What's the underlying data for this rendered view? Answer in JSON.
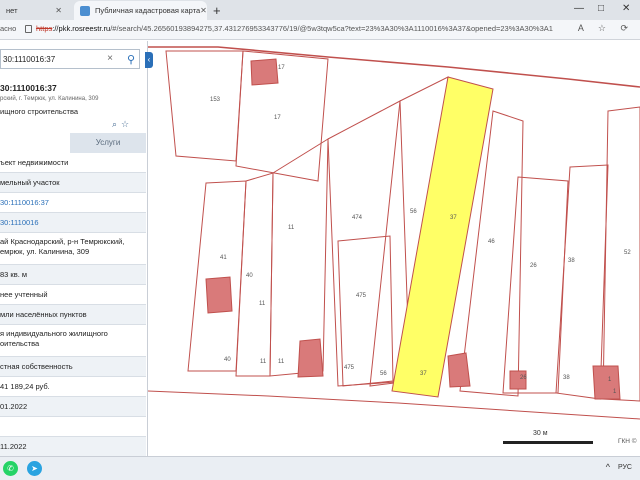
{
  "browser": {
    "tab_inactive": "нет",
    "tab_active": "Публичная кадастровая карта",
    "newtab_glyph": "+",
    "window_controls": [
      "—",
      "□",
      "✕"
    ],
    "addr_security": "асно",
    "url_scheme": "https",
    "url_host": "://pkk.rosreestr.ru",
    "url_rest": "/#/search/45.26560193894275,37.431276953343776/19/@5w3tqw5ca?text=23%3A30%3A1110016%3A37&opened=23%3A30%3A1",
    "addr_icons": "A ☆ ⟳"
  },
  "panel": {
    "search_value": "30:1110016:37",
    "obj_title": "30:1110016:37",
    "obj_address": "рский, г. Темрюк, ул. Калинина, 309",
    "obj_type": "ищного строительства",
    "tab_services": "Услуги",
    "rows": [
      {
        "text": "ъект недвижимости",
        "style": "plain"
      },
      {
        "text": "мельный участок",
        "style": "plain"
      },
      {
        "text": "30:1110016:37",
        "style": "link"
      },
      {
        "text": "30:1110016",
        "style": "link"
      },
      {
        "text": "ай Краснодарский, р-н Темрюкский, емрюк, ул. Калинина, 309",
        "style": "tall"
      },
      {
        "text": "83 кв. м",
        "style": "plain"
      },
      {
        "text": "нее учтенный",
        "style": "plain"
      },
      {
        "text": "мли населённых пунктов",
        "style": "plain"
      },
      {
        "text": "я индивидуального жилищного оительства",
        "style": "tall"
      },
      {
        "text": "стная собственность",
        "style": "plain"
      },
      {
        "text": "41 189,24 руб.",
        "style": "plain"
      },
      {
        "text": "01.2022",
        "style": "plain"
      },
      {
        "text": "",
        "style": "plain"
      },
      {
        "text": "11.2022",
        "style": "plain"
      }
    ]
  },
  "map": {
    "scale_label": "30 м",
    "copyright": "ГКН © ",
    "highlight_color": "#ffff66",
    "line_color": "#c0504d",
    "labels": [
      {
        "t": "153"
      },
      {
        "t": "17"
      },
      {
        "t": "17"
      },
      {
        "t": "11"
      },
      {
        "t": "41"
      },
      {
        "t": "40"
      },
      {
        "t": "11"
      },
      {
        "t": "40"
      },
      {
        "t": "11"
      },
      {
        "t": "11"
      },
      {
        "t": "474"
      },
      {
        "t": "475"
      },
      {
        "t": "475"
      },
      {
        "t": "56"
      },
      {
        "t": "56"
      },
      {
        "t": "37"
      },
      {
        "t": "37"
      },
      {
        "t": "46"
      },
      {
        "t": "26"
      },
      {
        "t": "26"
      },
      {
        "t": "38"
      },
      {
        "t": "38"
      },
      {
        "t": "52"
      },
      {
        "t": "1"
      },
      {
        "t": "1"
      }
    ]
  },
  "taskbar": {
    "lang": "РУС",
    "arrow": "^"
  }
}
